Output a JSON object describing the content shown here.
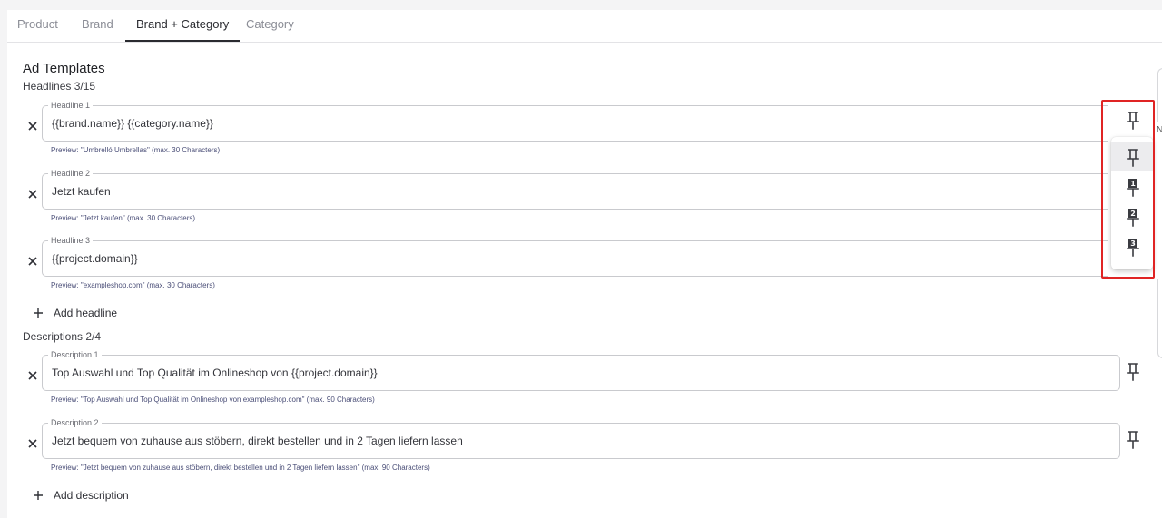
{
  "tabs": [
    {
      "label": "Product",
      "active": false
    },
    {
      "label": "Brand",
      "active": false
    },
    {
      "label": "Brand + Category",
      "active": true
    },
    {
      "label": "Category",
      "active": false
    }
  ],
  "ad_templates": {
    "title": "Ad Templates",
    "headlines_heading": "Headlines 3/15",
    "headlines": [
      {
        "label": "Headline 1",
        "value": "{{brand.name}} {{category.name}}",
        "preview": "Preview: \"Umbrelló Umbrellas\" (max. 30 Characters)"
      },
      {
        "label": "Headline 2",
        "value": "Jetzt kaufen",
        "preview": "Preview: \"Jetzt kaufen\" (max. 30 Characters)"
      },
      {
        "label": "Headline 3",
        "value": "{{project.domain}}",
        "preview": "Preview: \"exampleshop.com\" (max. 30 Characters)"
      }
    ],
    "add_headline_label": "Add headline",
    "descriptions_heading": "Descriptions 2/4",
    "descriptions": [
      {
        "label": "Description 1",
        "value": "Top Auswahl und Top Qualität im Onlineshop von {{project.domain}}",
        "preview": "Preview: \"Top Auswahl und Top Qualität im Onlineshop von exampleshop.com\" (max. 90 Characters)"
      },
      {
        "label": "Description 2",
        "value": "Jetzt bequem von zuhause aus stöbern, direkt bestellen und in 2 Tagen liefern lassen",
        "preview": "Preview: \"Jetzt bequem von zuhause aus stöbern, direkt bestellen und in 2 Tagen liefern lassen\" (max. 90 Characters)"
      }
    ],
    "add_description_label": "Add description"
  },
  "pin_menu": {
    "options": [
      {
        "icon": "pin-icon",
        "number": ""
      },
      {
        "icon": "pin-1-icon",
        "number": "1"
      },
      {
        "icon": "pin-2-icon",
        "number": "2"
      },
      {
        "icon": "pin-3-icon",
        "number": "3"
      }
    ],
    "selected_index": 0
  },
  "side_panel": {
    "letter": "N"
  },
  "colors": {
    "highlight": "#e02424",
    "preview_text": "#4b4f78",
    "active_tab": "#2a2b30"
  }
}
